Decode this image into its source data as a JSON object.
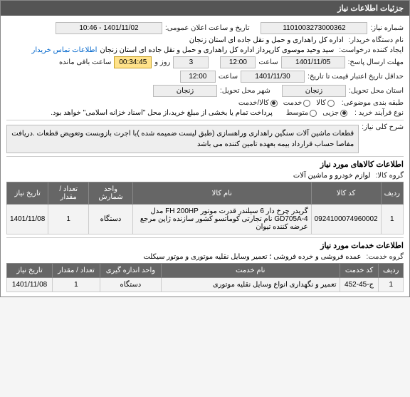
{
  "header": {
    "title": "جزئیات اطلاعات نیاز"
  },
  "fields": {
    "shomare_niaz_lbl": "شماره نیاز:",
    "shomare_niaz": "1101003273000362",
    "tarikh_elan_lbl": "تاریخ و ساعت اعلان عمومی:",
    "tarikh_elan": "1401/11/02 - 10:46",
    "kharidar_lbl": "نام دستگاه خریدار:",
    "kharidar": "اداره کل راهداری و حمل و نقل جاده ای استان زنجان",
    "ijad_lbl": "ایجاد کننده درخواست:",
    "ijad": "سید وحید موسوی کارپرداز اداره کل راهداری و حمل و نقل جاده ای استان زنجان",
    "tamas_link": "اطلاعات تماس خریدار",
    "mohlat_lbl": "مهلت ارسال پاسخ:",
    "mohlat_date": "1401/11/05",
    "saat_lbl": "ساعت",
    "mohlat_time": "12:00",
    "rooz_lbl": "روز و",
    "rooz_val": "3",
    "countdown": "00:34:45",
    "countdown_lbl": "ساعت باقی مانده",
    "etebar_lbl": "حداقل تاریخ اعتبار قیمت تا تاریخ:",
    "etebar_date": "1401/11/30",
    "etebar_time": "12:00",
    "ostan_lbl": "استان محل تحویل:",
    "ostan": "زنجان",
    "shahr_lbl": "شهر محل تحویل:",
    "shahr": "زنجان",
    "tabaghe_lbl": "طبقه بندی موضوعی:",
    "kala_lbl": "کالا",
    "khadmat_lbl": "خدمت",
    "kala_khadmat_lbl": "کالا/خدمت",
    "farayand_lbl": "نوع فرآیند خرید :",
    "jozi_lbl": "جزیی",
    "motevasset_lbl": "متوسط",
    "note": "پرداخت تمام یا بخشی از مبلغ خرید،از محل \"اسناد خزانه اسلامی\" خواهد بود.",
    "sharh_lbl": "شرح کلی نیاز:",
    "sharh": "قطعات ماشین آلات سنگین راهداری وراهسازی (طبق لیست ضمیمه شده )با اجرت بازوبست وتعویض قطعات .دریافت مفاصا حساب قرارداد بیمه بعهده تامین کننده می باشد"
  },
  "kala_section": {
    "title": "اطلاعات کالاهای مورد نیاز",
    "group_lbl": "گروه کالا:",
    "group": "لوازم خودرو و ماشین آلات",
    "headers": {
      "radif": "ردیف",
      "code": "کد کالا",
      "name": "نام کالا",
      "vahed": "واحد شمارش",
      "tedad": "تعداد / مقدار",
      "tarikh": "تاریخ نیاز"
    },
    "rows": [
      {
        "radif": "1",
        "code": "0924100074960002",
        "name": "گریدر چرخ دار 6 سیلندر قدرت موتور FH 200HP مدل GD705A-4 نام تجارتی کوماتسو کشور سازنده ژاپن مرجع عرضه کننده تیوان",
        "vahed": "دستگاه",
        "tedad": "1",
        "tarikh": "1401/11/08"
      }
    ]
  },
  "khadmat_section": {
    "title": "اطلاعات خدمات مورد نیاز",
    "group_lbl": "گروه خدمت:",
    "group": "عمده فروشی و خرده فروشی ؛ تعمیر وسایل نقلیه موتوری و موتور سیکلت",
    "headers": {
      "radif": "ردیف",
      "code": "کد خدمت",
      "name": "نام خدمت",
      "vahed": "واحد اندازه گیری",
      "tedad": "تعداد / مقدار",
      "tarikh": "تاریخ نیاز"
    },
    "rows": [
      {
        "radif": "1",
        "code": "ج-45-452",
        "name": "تعمیر و نگهداری انواع وسایل نقلیه موتوری",
        "vahed": "دستگاه",
        "tedad": "1",
        "tarikh": "1401/11/08"
      }
    ]
  }
}
